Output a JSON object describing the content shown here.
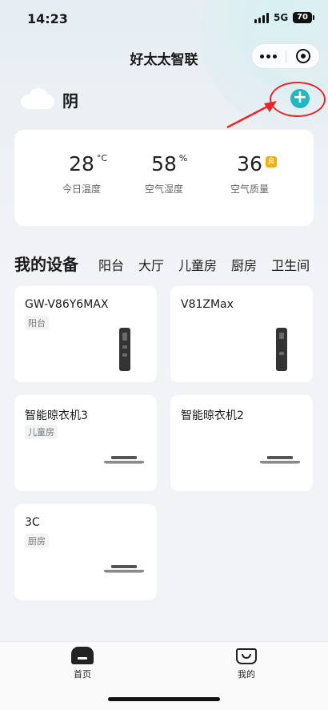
{
  "status_bar": {
    "time": "14:23",
    "network": "5G",
    "battery": "70"
  },
  "nav": {
    "title": "好太太智联"
  },
  "weather": {
    "condition": "阴",
    "icon": "cloud-icon",
    "metrics": [
      {
        "value": "28",
        "unit": "°C",
        "label": "今日温度"
      },
      {
        "value": "58",
        "unit": "%",
        "label": "空气湿度"
      },
      {
        "value": "36",
        "badge": "良",
        "label": "空气质量"
      }
    ],
    "badge_color": "#f4b000"
  },
  "devices_section": {
    "title": "我的设备",
    "room_tabs": [
      "阳台",
      "大厅",
      "儿童房",
      "厨房",
      "卫生间"
    ]
  },
  "devices": [
    {
      "name": "GW-V86Y6MAX",
      "room": "阳台",
      "icon": "smart-lock-icon"
    },
    {
      "name": "V81ZMax",
      "room": "",
      "icon": "smart-lock-icon"
    },
    {
      "name": "智能晾衣机3",
      "room": "儿童房",
      "icon": "clothes-rack-icon"
    },
    {
      "name": "智能晾衣机2",
      "room": "",
      "icon": "clothes-rack-icon"
    },
    {
      "name": "3C",
      "room": "厨房",
      "icon": "clothes-rack-icon"
    }
  ],
  "tab_bar": {
    "home_label": "首页",
    "mine_label": "我的"
  },
  "colors": {
    "accent": "#22b5c3",
    "annotation": "#e8262a"
  }
}
